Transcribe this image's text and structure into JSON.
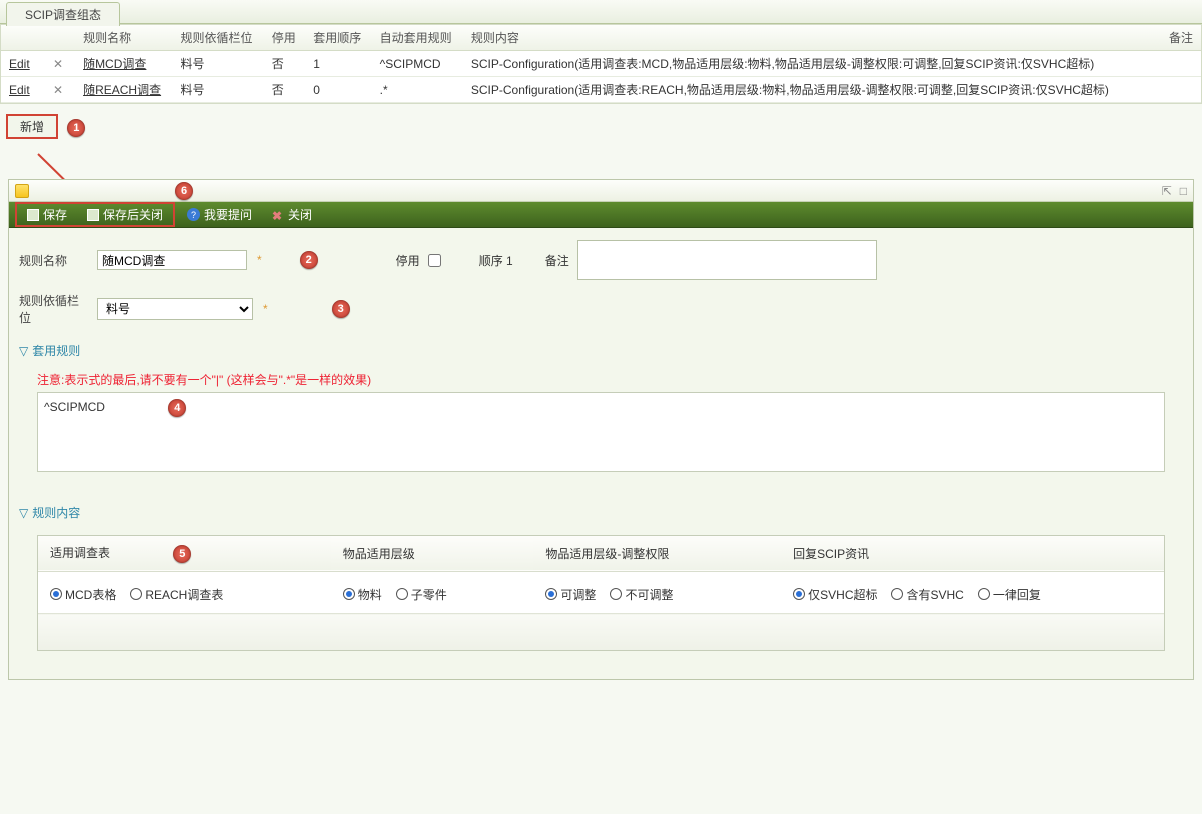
{
  "tab": {
    "title": "SCIP调查组态"
  },
  "grid": {
    "headers": {
      "name": "规则名称",
      "col": "规则依循栏位",
      "disabled": "停用",
      "order": "套用顺序",
      "auto": "自动套用规则",
      "content": "规则内容",
      "remark": "备注"
    },
    "editLabel": "Edit",
    "rows": [
      {
        "name": "随MCD调查",
        "col": "料号",
        "disabled": "否",
        "order": "1",
        "auto": "^SCIPMCD",
        "content": "SCIP-Configuration(适用调查表:MCD,物品适用层级:物料,物品适用层级-调整权限:可调整,回复SCIP资讯:仅SVHC超标)"
      },
      {
        "name": "随REACH调查",
        "col": "料号",
        "disabled": "否",
        "order": "0",
        "auto": ".*",
        "content": "SCIP-Configuration(适用调查表:REACH,物品适用层级:物料,物品适用层级-调整权限:可调整,回复SCIP资讯:仅SVHC超标)"
      }
    ]
  },
  "addBtn": "新增",
  "markers": {
    "m1": "1",
    "m2": "2",
    "m3": "3",
    "m4": "4",
    "m5": "5",
    "m6": "6"
  },
  "toolbar": {
    "save": "保存",
    "saveClose": "保存后关闭",
    "ask": "我要提问",
    "close": "关闭"
  },
  "form": {
    "nameLabel": "规则名称",
    "nameValue": "随MCD调查",
    "disableLabel": "停用",
    "orderLabel": "顺序",
    "orderValue": "1",
    "remarkLabel": "备注",
    "remarkValue": "",
    "colLabel": "规则依循栏位",
    "colValue": "料号"
  },
  "section1": {
    "title": "套用规则",
    "note": "注意:表示式的最后,请不要有一个\"|\" (这样会与\".*\"是一样的效果)",
    "expr": "^SCIPMCD"
  },
  "section2": {
    "title": "规则内容",
    "cols": {
      "survey": "适用调查表",
      "level": "物品适用层级",
      "levelAdj": "物品适用层级-调整权限",
      "reply": "回复SCIP资讯"
    },
    "survey": {
      "opt1": "MCD表格",
      "opt2": "REACH调查表",
      "sel": 0
    },
    "level": {
      "opt1": "物料",
      "opt2": "子零件",
      "sel": 0
    },
    "levelAdj": {
      "opt1": "可调整",
      "opt2": "不可调整",
      "sel": 0
    },
    "reply": {
      "opt1": "仅SVHC超标",
      "opt2": "含有SVHC",
      "opt3": "一律回复",
      "sel": 0
    }
  }
}
